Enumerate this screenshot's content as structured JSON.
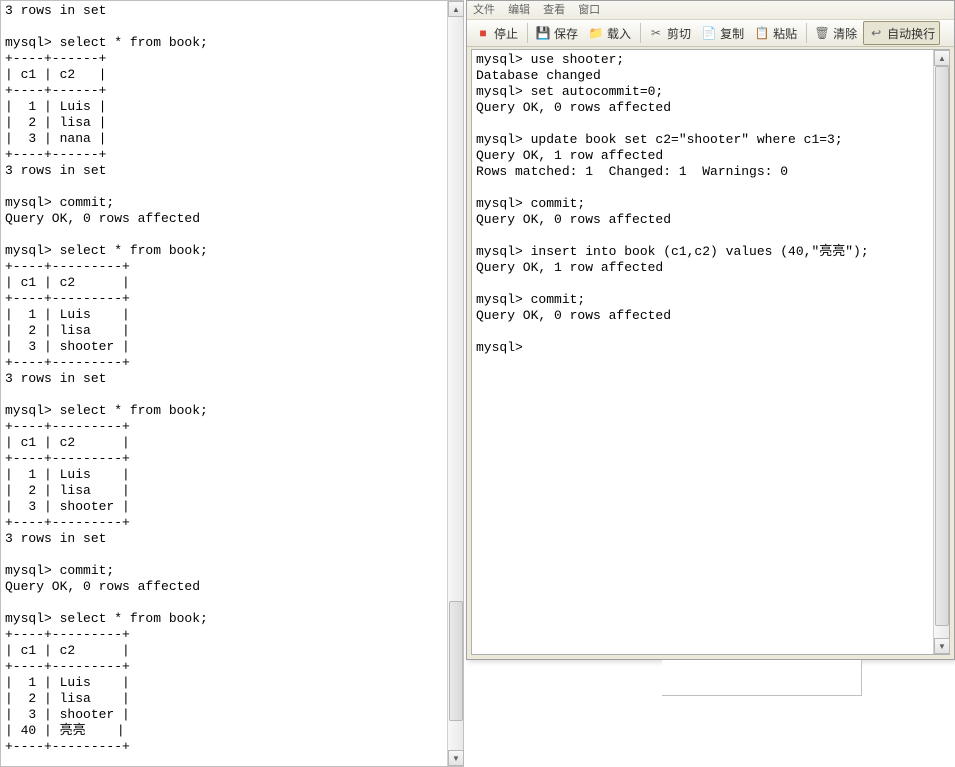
{
  "left_terminal_text": "3 rows in set\n\nmysql> select * from book;\n+----+------+\n| c1 | c2   |\n+----+------+\n|  1 | Luis |\n|  2 | lisa |\n|  3 | nana |\n+----+------+\n3 rows in set\n\nmysql> commit;\nQuery OK, 0 rows affected\n\nmysql> select * from book;\n+----+---------+\n| c1 | c2      |\n+----+---------+\n|  1 | Luis    |\n|  2 | lisa    |\n|  3 | shooter |\n+----+---------+\n3 rows in set\n\nmysql> select * from book;\n+----+---------+\n| c1 | c2      |\n+----+---------+\n|  1 | Luis    |\n|  2 | lisa    |\n|  3 | shooter |\n+----+---------+\n3 rows in set\n\nmysql> commit;\nQuery OK, 0 rows affected\n\nmysql> select * from book;\n+----+---------+\n| c1 | c2      |\n+----+---------+\n|  1 | Luis    |\n|  2 | lisa    |\n|  3 | shooter |\n| 40 | 亮亮    |\n+----+---------+",
  "right_terminal_text": "mysql> use shooter;\nDatabase changed\nmysql> set autocommit=0;\nQuery OK, 0 rows affected\n\nmysql> update book set c2=\"shooter\" where c1=3;\nQuery OK, 1 row affected\nRows matched: 1  Changed: 1  Warnings: 0\n\nmysql> commit;\nQuery OK, 0 rows affected\n\nmysql> insert into book (c1,c2) values (40,\"亮亮\");\nQuery OK, 1 row affected\n\nmysql> commit;\nQuery OK, 0 rows affected\n\nmysql>",
  "menubar": {
    "file": "文件",
    "edit": "编辑",
    "view": "查看",
    "window": "窗口"
  },
  "toolbar": {
    "stop": "停止",
    "save": "保存",
    "load": "载入",
    "cut": "剪切",
    "copy": "复制",
    "paste": "粘贴",
    "clear": "清除",
    "wrap": "自动换行"
  },
  "icons": {
    "scroll_up": "▲",
    "scroll_down": "▼",
    "stop": "■",
    "save": "💾",
    "load": "📁",
    "cut": "✂",
    "copy": "📄",
    "paste": "📋",
    "clear": "🗑",
    "wrap": "↩"
  }
}
